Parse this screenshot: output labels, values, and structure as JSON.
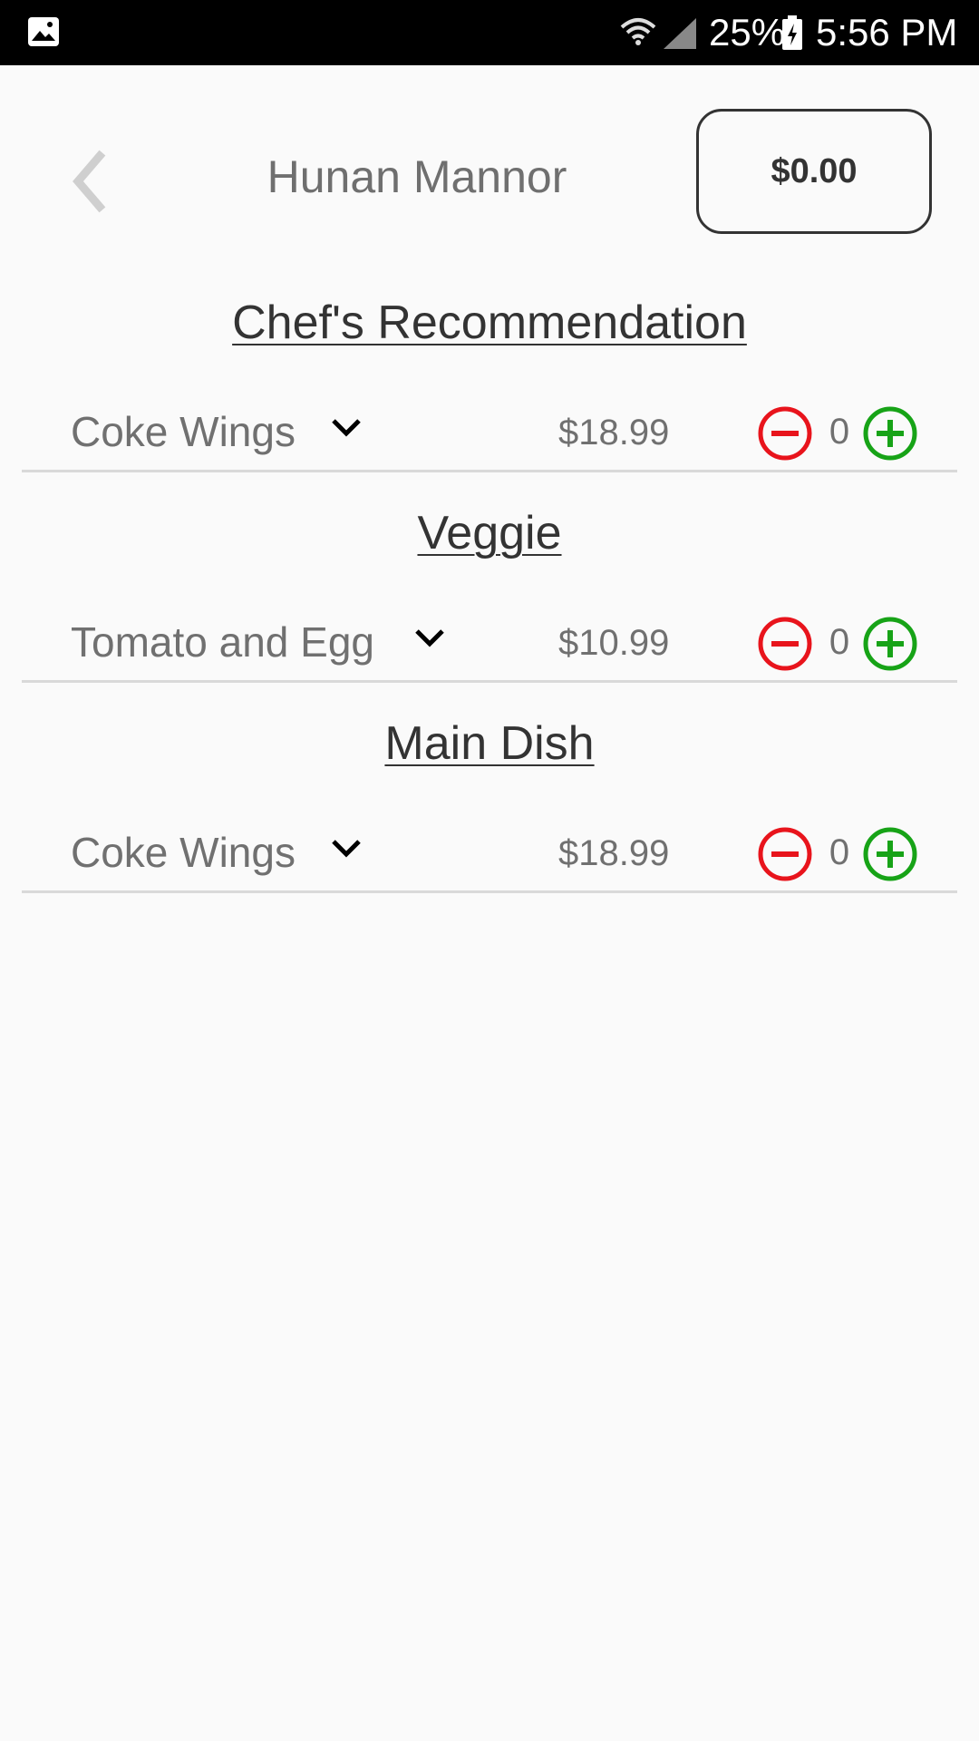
{
  "status_bar": {
    "battery": "25%",
    "time": "5:56 PM",
    "icons": [
      "gallery-icon",
      "wifi-icon",
      "signal-icon",
      "battery-icon"
    ]
  },
  "header": {
    "title": "Hunan Mannor",
    "cart_total": "$0.00",
    "back_icon": "chevron-left-icon"
  },
  "sections": [
    {
      "title": "Chef's Recommendation",
      "items": [
        {
          "name": "Coke Wings",
          "price": "$18.99",
          "quantity": "0"
        }
      ]
    },
    {
      "title": "Veggie",
      "items": [
        {
          "name": "Tomato and Egg",
          "price": "$10.99",
          "quantity": "0"
        }
      ]
    },
    {
      "title": "Main Dish",
      "items": [
        {
          "name": "Coke Wings",
          "price": "$18.99",
          "quantity": "0"
        }
      ]
    }
  ],
  "colors": {
    "minus": "#e8141c",
    "plus": "#17a317",
    "text": "#707070",
    "title": "#333333"
  }
}
